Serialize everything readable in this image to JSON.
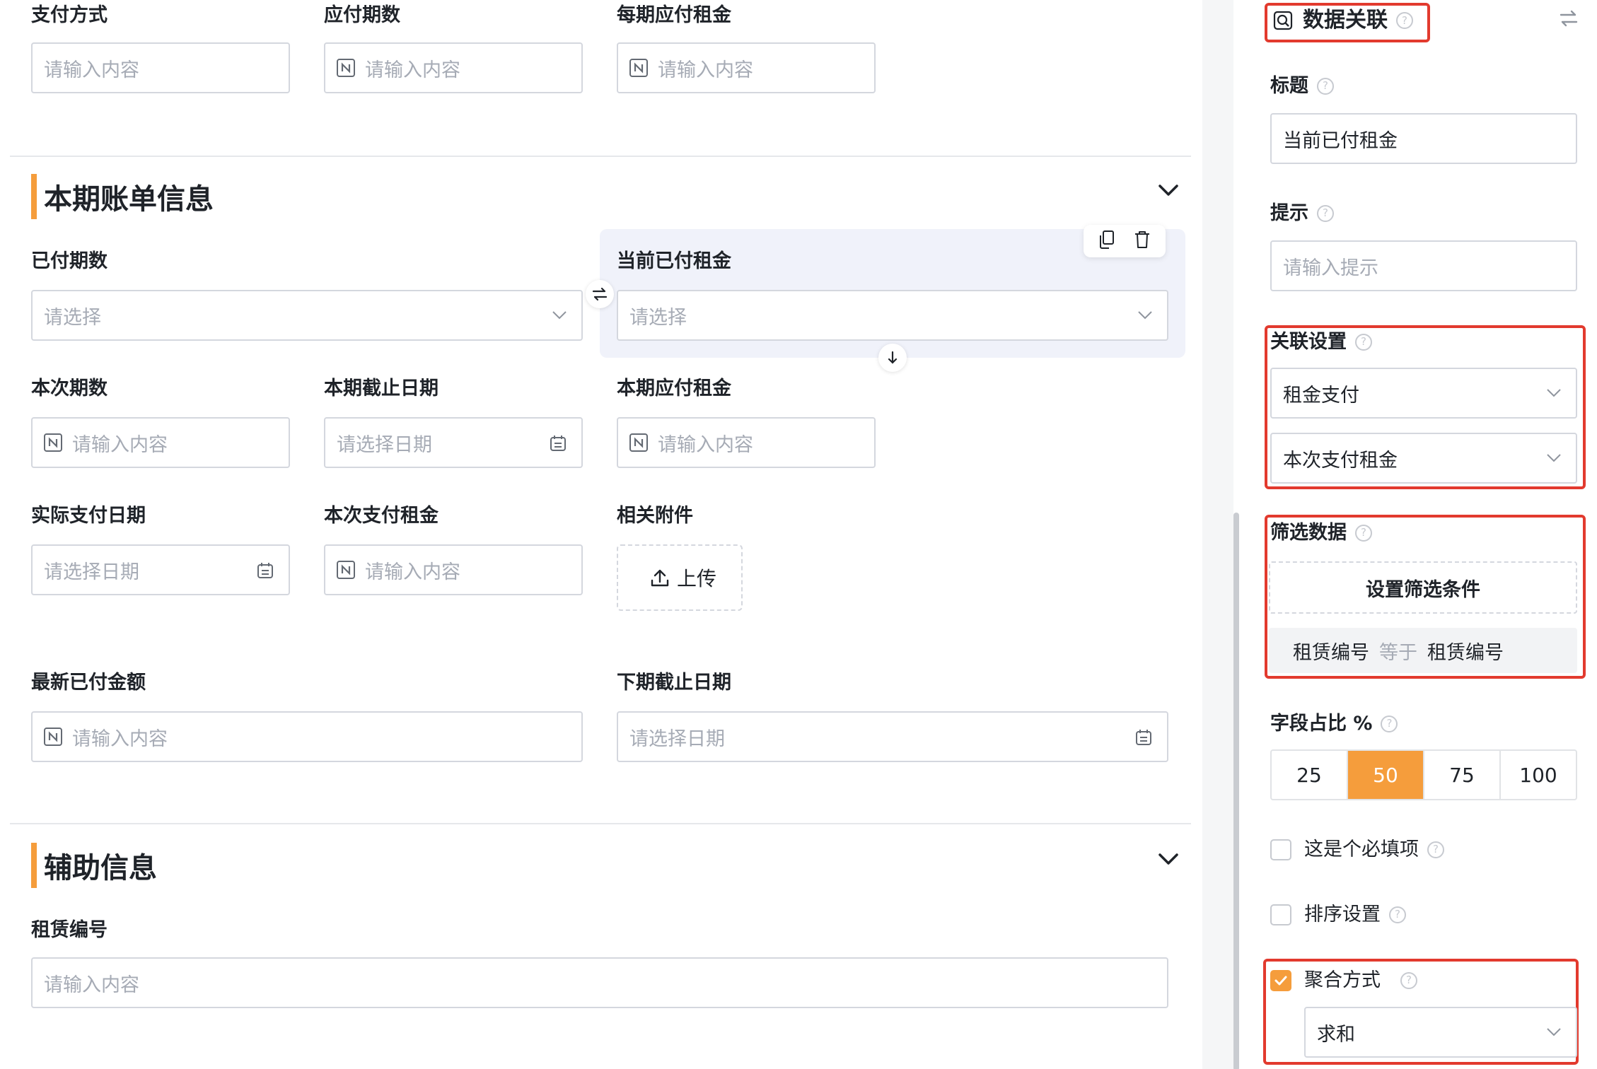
{
  "form": {
    "top_fields": [
      {
        "label": "支付方式",
        "placeholder": "请输入内容"
      },
      {
        "label": "应付期数",
        "placeholder": "请输入内容"
      },
      {
        "label": "每期应付租金",
        "placeholder": "请输入内容"
      }
    ],
    "section1": {
      "title": "本期账单信息",
      "paid_periods": {
        "label": "已付期数",
        "placeholder": "请选择"
      },
      "current_paid_rent": {
        "label": "当前已付租金",
        "placeholder": "请选择"
      },
      "this_period_count": {
        "label": "本次期数",
        "placeholder": "请输入内容"
      },
      "period_end_date": {
        "label": "本期截止日期",
        "placeholder": "请选择日期"
      },
      "period_rent_due": {
        "label": "本期应付租金",
        "placeholder": "请输入内容"
      },
      "actual_pay_date": {
        "label": "实际支付日期",
        "placeholder": "请选择日期"
      },
      "this_pay_rent": {
        "label": "本次支付租金",
        "placeholder": "请输入内容"
      },
      "attachments": {
        "label": "相关附件",
        "upload_label": "上传"
      },
      "latest_paid_amount": {
        "label": "最新已付金额",
        "placeholder": "请输入内容"
      },
      "next_end_date": {
        "label": "下期截止日期",
        "placeholder": "请选择日期"
      }
    },
    "section2": {
      "title": "辅助信息",
      "lease_no": {
        "label": "租赁编号",
        "placeholder": "请输入内容"
      }
    }
  },
  "panel": {
    "title": "数据关联",
    "title_label": "标题",
    "title_value": "当前已付租金",
    "hint_label": "提示",
    "hint_placeholder": "请输入提示",
    "link_label": "关联设置",
    "link_form": "租金支付",
    "link_field": "本次支付租金",
    "filter_label": "筛选数据",
    "filter_button": "设置筛选条件",
    "filter_condition": {
      "left": "租赁编号",
      "op": "等于",
      "right": "租赁编号"
    },
    "width_label": "字段占比 %",
    "width_options": [
      "25",
      "50",
      "75",
      "100"
    ],
    "width_selected": "50",
    "required_label": "这是个必填项",
    "required_checked": false,
    "sort_label": "排序设置",
    "sort_checked": false,
    "aggregate_label": "聚合方式",
    "aggregate_checked": true,
    "aggregate_value": "求和"
  },
  "colors": {
    "accent": "#f59d3c",
    "highlight": "#e23a2e",
    "selected_bg": "#f0f2fa"
  }
}
